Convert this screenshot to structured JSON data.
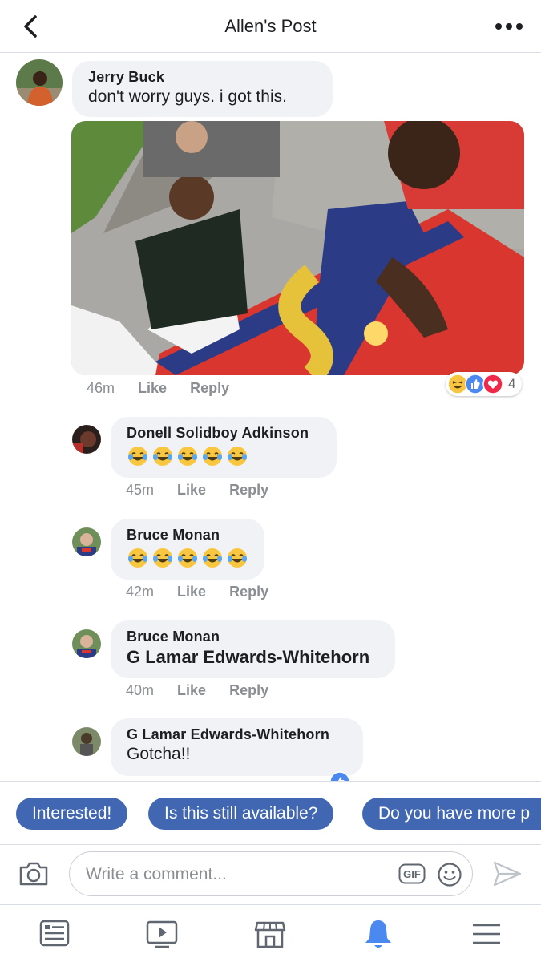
{
  "header": {
    "title": "Allen's Post",
    "back_icon": "chevron-left-icon",
    "more_icon": "more-dots-icon"
  },
  "comments": [
    {
      "name": "Jerry Buck",
      "text": "don't worry guys. i got this.",
      "time": "46m",
      "like": "Like",
      "reply": "Reply",
      "reaction_count": "4",
      "reactions": [
        "haha",
        "like",
        "love"
      ]
    },
    {
      "name": "Donell Solidboy Adkinson",
      "emoji": "tears-of-joy",
      "emoji_count": 5,
      "time": "45m",
      "like": "Like",
      "reply": "Reply"
    },
    {
      "name": "Bruce Monan",
      "emoji": "tears-of-joy",
      "emoji_count": 5,
      "time": "42m",
      "like": "Like",
      "reply": "Reply"
    },
    {
      "name": "Bruce Monan",
      "text": "G Lamar Edwards-Whitehorn",
      "time": "40m",
      "like": "Like",
      "reply": "Reply"
    },
    {
      "name": "G Lamar Edwards-Whitehorn",
      "text": "Gotcha!!"
    }
  ],
  "quick_replies": [
    "Interested!",
    "Is this still available?",
    "Do you have more p"
  ],
  "composer": {
    "placeholder": "Write a comment...",
    "gif_label": "GIF",
    "camera_icon": "camera-icon",
    "emoji_icon": "smiley-icon",
    "send_icon": "send-icon"
  },
  "tabs": [
    "news-feed-icon",
    "watch-icon",
    "marketplace-icon",
    "notifications-icon",
    "menu-icon"
  ],
  "colors": {
    "accent": "#4267b2",
    "bubble": "#f0f2f5",
    "meta": "#8a8d91",
    "active_tab": "#4b89f0",
    "love": "#f0284a",
    "haha": "#f7c541"
  }
}
